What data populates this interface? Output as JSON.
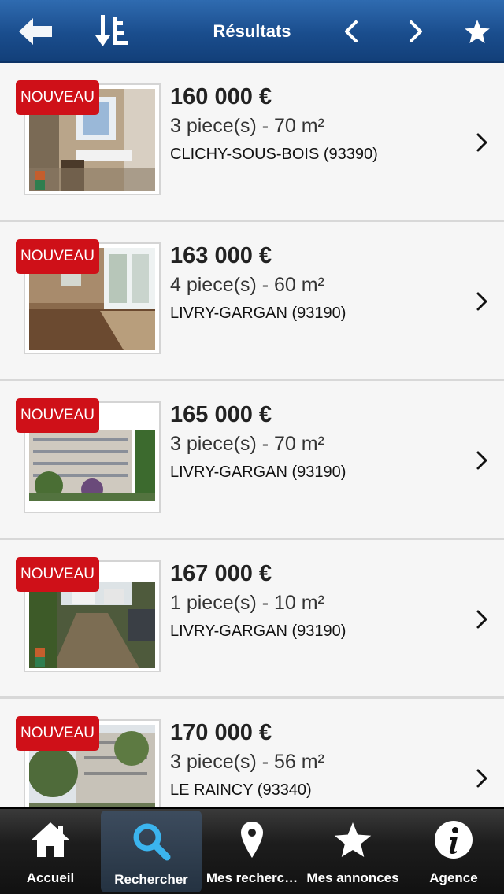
{
  "header": {
    "title": "Résultats",
    "buttons": [
      "back-arrow-icon",
      "sort-icon",
      "previous-chevron-icon",
      "next-chevron-icon",
      "star-icon"
    ]
  },
  "colors": {
    "header_blue": "#1a4d8d",
    "badge_red": "#cf1018",
    "active_tab": "#3bb4ee"
  },
  "listings": [
    {
      "badge": "NOUVEAU",
      "price": "160 000 €",
      "specs": "3 piece(s) - 70 m²",
      "city": "CLICHY-SOUS-BOIS (93390)",
      "photo": "kitchen-interior"
    },
    {
      "badge": "NOUVEAU",
      "price": "163 000 €",
      "specs": "4 piece(s) - 60 m²",
      "city": "LIVRY-GARGAN (93190)",
      "photo": "empty-room-window"
    },
    {
      "badge": "NOUVEAU",
      "price": "165 000 €",
      "specs": "3 piece(s) - 70 m²",
      "city": "LIVRY-GARGAN (93190)",
      "photo": "apartment-building"
    },
    {
      "badge": "NOUVEAU",
      "price": "167 000 €",
      "specs": "1 piece(s) - 10 m²",
      "city": "LIVRY-GARGAN (93190)",
      "photo": "parking-lot"
    },
    {
      "badge": "NOUVEAU",
      "price": "170 000 €",
      "specs": "3 piece(s) - 56 m²",
      "city": "LE RAINCY (93340)",
      "photo": "building-trees"
    }
  ],
  "tabs": [
    {
      "label": "Accueil",
      "icon": "home-icon",
      "active": false
    },
    {
      "label": "Rechercher",
      "icon": "search-icon",
      "active": true
    },
    {
      "label": "Mes recherc…",
      "icon": "map-pin-icon",
      "active": false
    },
    {
      "label": "Mes annonces",
      "icon": "star-icon",
      "active": false
    },
    {
      "label": "Agence",
      "icon": "info-icon",
      "active": false
    }
  ]
}
